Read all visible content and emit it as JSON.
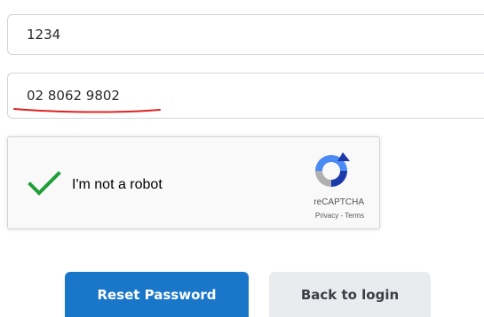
{
  "form": {
    "field_1": {
      "value": "1234"
    },
    "field_2": {
      "value": "02 8062 9802"
    }
  },
  "recaptcha": {
    "checkbox_label": "I'm not a robot",
    "brand": "reCAPTCHA",
    "privacy_link": "Privacy",
    "separator": " - ",
    "terms_link": "Terms",
    "checked": true
  },
  "buttons": {
    "reset_label": "Reset Password",
    "back_label": "Back to login"
  },
  "colors": {
    "primary_button": "#1a76c8",
    "secondary_button": "#e9ecef",
    "check_green": "#1f9e3a",
    "underline_red": "#e02020"
  }
}
